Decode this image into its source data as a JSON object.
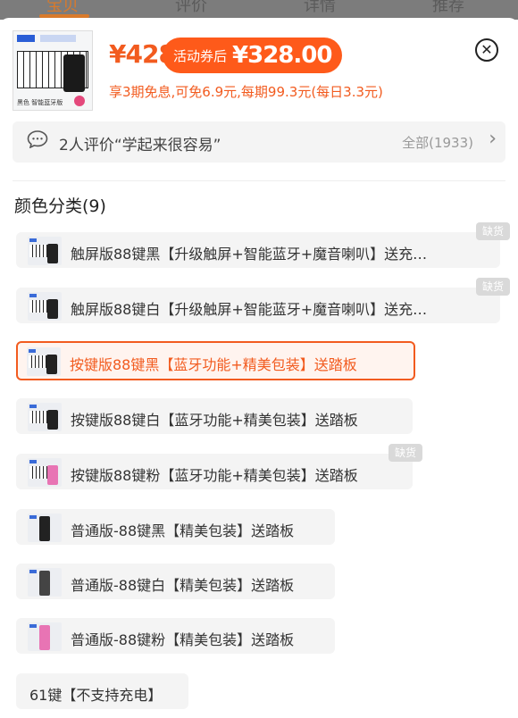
{
  "background": {
    "tabs": [
      "宝贝",
      "评价",
      "详情",
      "推荐"
    ],
    "active_tab": 0
  },
  "product": {
    "thumb_caption": "黑色  智能蓝牙版",
    "price": "¥428",
    "coupon_label": "活动券后",
    "coupon_price": "¥328.00",
    "installment": "享3期免息,可免6.9元,每期99.3元(每日3.3元)",
    "close_icon": "close-circle-icon"
  },
  "reviews": {
    "text": "2人评价“学起来很容易”",
    "all_link": "全部(1933)",
    "icon": "chat-bubble-icon"
  },
  "section": {
    "title": "颜色分类(9)"
  },
  "options": [
    {
      "label": "触屏版88键黑【升级触屏+智能蓝牙+魔音喇叭】送充…",
      "out_of_stock": "缺货",
      "selected": false,
      "thumb": "piano-speaker"
    },
    {
      "label": "触屏版88键白【升级触屏+智能蓝牙+魔音喇叭】送充…",
      "out_of_stock": "缺货",
      "selected": false,
      "thumb": "piano-speaker"
    },
    {
      "label": "按键版88键黑【蓝牙功能+精美包装】送踏板",
      "out_of_stock": "",
      "selected": true,
      "thumb": "piano-speaker"
    },
    {
      "label": "按键版88键白【蓝牙功能+精美包装】送踏板",
      "out_of_stock": "",
      "selected": false,
      "thumb": "piano-speaker"
    },
    {
      "label": "按键版88键粉【蓝牙功能+精美包装】送踏板",
      "out_of_stock": "缺货",
      "selected": false,
      "thumb": "piano-pink"
    },
    {
      "label": "普通版-88键黑【精美包装】送踏板",
      "out_of_stock": "",
      "selected": false,
      "thumb": "tower"
    },
    {
      "label": "普通版-88键白【精美包装】送踏板",
      "out_of_stock": "",
      "selected": false,
      "thumb": "tower"
    },
    {
      "label": "普通版-88键粉【精美包装】送踏板",
      "out_of_stock": "",
      "selected": false,
      "thumb": "tower-pink"
    },
    {
      "label": "61键【不支持充电】",
      "out_of_stock": "",
      "selected": false,
      "thumb": ""
    }
  ],
  "colors": {
    "accent": "#f25b1f",
    "coupon_bg": "#fe5a1a",
    "option_bg": "#f4f4f4",
    "out_of_stock_bg": "#d9d9d9"
  }
}
